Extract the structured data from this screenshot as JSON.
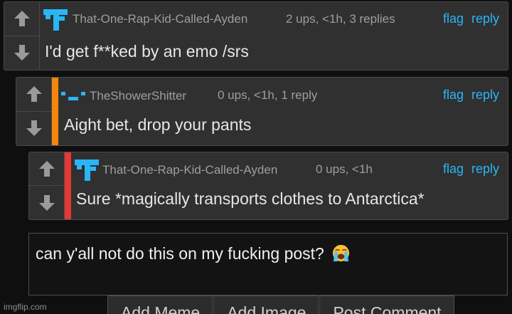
{
  "comments": [
    {
      "username": "That-One-Rap-Kid-Called-Ayden",
      "meta": "2 ups, <1h, 3 replies",
      "flag": "flag",
      "reply": "reply",
      "text": "I'd get f**ked by an emo /srs",
      "stripe_color": null
    },
    {
      "username": "TheShowerShitter",
      "meta": "0 ups, <1h, 1 reply",
      "flag": "flag",
      "reply": "reply",
      "text": "Aight bet, drop your pants",
      "stripe_color": "#f5860c"
    },
    {
      "username": "That-One-Rap-Kid-Called-Ayden",
      "meta": "0 ups, <1h",
      "flag": "flag",
      "reply": "reply",
      "text": "Sure *magically transports clothes to Antarctica*",
      "stripe_color": "#e53935"
    }
  ],
  "reply_box": {
    "value": "can y'all not do this on my fucking post?",
    "emoji_icon": "loudly-crying-face-icon"
  },
  "buttons": {
    "add_meme": "Add Meme",
    "add_image": "Add Image",
    "post_comment": "Post Comment"
  },
  "watermark": "imgflip.com",
  "colors": {
    "link": "#29b6f6",
    "avatar": "#29b6f6",
    "panel": "#303030",
    "background": "#0f0f0f"
  }
}
